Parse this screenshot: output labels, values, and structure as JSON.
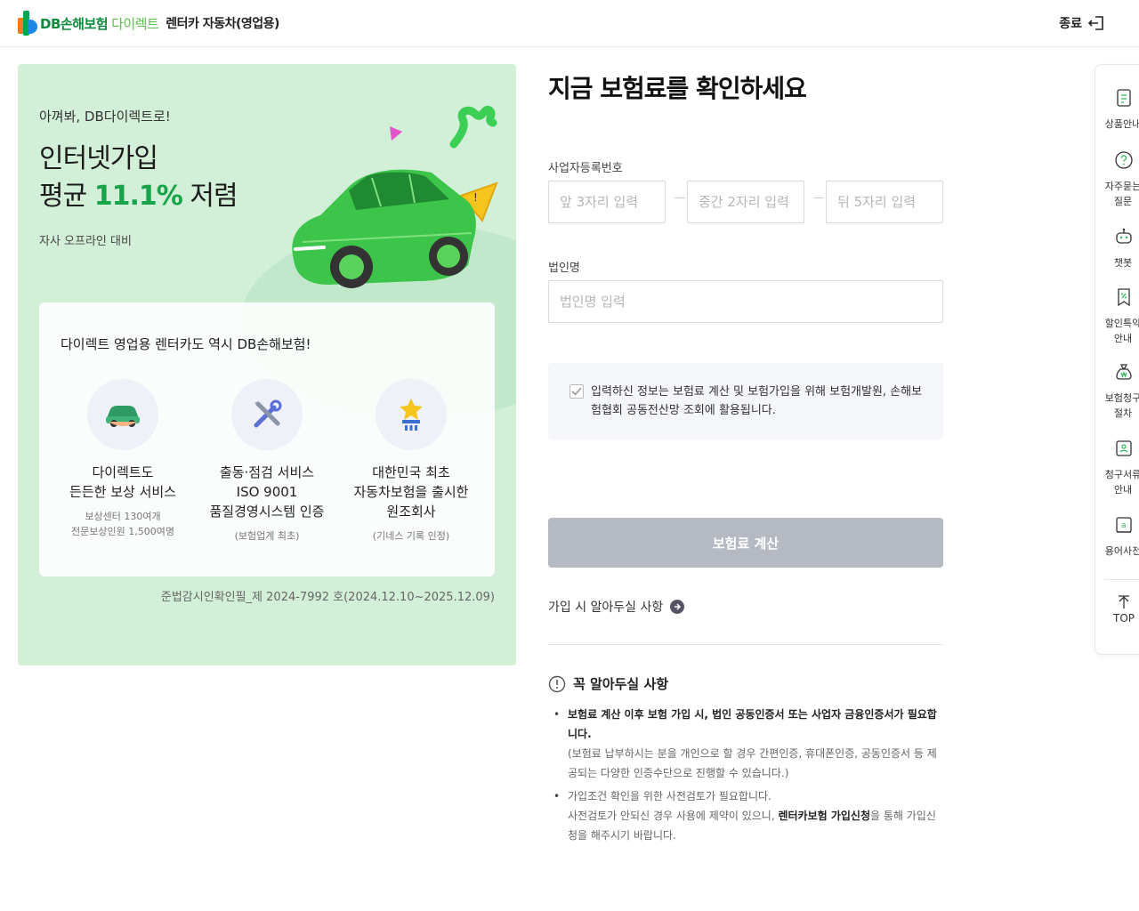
{
  "header": {
    "brand": "DB손해보험",
    "brand_sub": "다이렉트",
    "page_title": "렌터카 자동차(영업용)",
    "exit_label": "종료"
  },
  "promo": {
    "eyebrow": "아껴봐, DB다이렉트로!",
    "title_line1": "인터넷가입",
    "title_line2_pre": "평균 ",
    "title_pct": "11.1%",
    "title_line2_post": " 저렴",
    "note": "자사 오프라인 대비",
    "card_title": "다이렉트 영업용 렌터카도 역시 DB손해보험!",
    "features": [
      {
        "title": "다이렉트도\n든든한 보상 서비스",
        "sub": "보상센터 130여개\n전문보상인원 1,500여명"
      },
      {
        "title": "출동·점검 서비스\nISO 9001\n품질경영시스템 인증",
        "sub": "(보험업계 최초)"
      },
      {
        "title": "대한민국 최초\n자동차보험을 출시한\n원조회사",
        "sub": "(기네스 기록 인정)"
      }
    ],
    "footnote": "준법감시인확인필_제 2024-7992 호(2024.12.10~2025.12.09)"
  },
  "form": {
    "title": "지금 보험료를 확인하세요",
    "biz_label": "사업자등록번호",
    "biz_placeholder_1": "앞 3자리 입력",
    "biz_placeholder_2": "중간 2자리 입력",
    "biz_placeholder_3": "뒤 5자리 입력",
    "corp_label": "법인명",
    "corp_placeholder": "법인명 입력",
    "consent_text": "입력하신 정보는 보험료 계산 및 보험가입을 위해 보험개발원, 손해보험협회 공동전산망 조회에 활용됩니다.",
    "calc_button": "보험료 계산",
    "notice_link": "가입 시 알아두실 사항",
    "must_title": "꼭 알아두실 사항",
    "must_1_strong": "보험료 계산 이후 보험 가입 시, 법인 공동인증서 또는 사업자 금융인증서가 필요합니다.",
    "must_1_sub": "(보험료 납부하시는 분을 개인으로 할 경우 간편인증, 휴대폰인증, 공동인증서 등 제공되는 다양한 인증수단으로 진행할 수 있습니다.)",
    "must_2_line1": "가입조건 확인을 위한 사전검토가 필요합니다.",
    "must_2_pre": "사전검토가 안되신 경우 사용에 제약이 있으니, ",
    "must_2_strong": "렌터카보험 가입신청",
    "must_2_post": "을 통해 가입신청을 해주시기 바랍니다."
  },
  "quick_menu": {
    "items": [
      {
        "label": "상품안내",
        "icon": "document-icon"
      },
      {
        "label": "자주묻는\n질문",
        "icon": "question-icon"
      },
      {
        "label": "챗봇",
        "icon": "chatbot-icon"
      },
      {
        "label": "할인특약\n안내",
        "icon": "discount-icon"
      },
      {
        "label": "보험청구\n절차",
        "icon": "money-bag-icon"
      },
      {
        "label": "청구서류\n안내",
        "icon": "claim-doc-icon"
      },
      {
        "label": "용어사전",
        "icon": "dictionary-icon"
      }
    ],
    "top_label": "TOP"
  },
  "colors": {
    "brand_green": "#17a34a",
    "promo_bg": "#d2efd8",
    "button_disabled": "#b4b9c2"
  }
}
